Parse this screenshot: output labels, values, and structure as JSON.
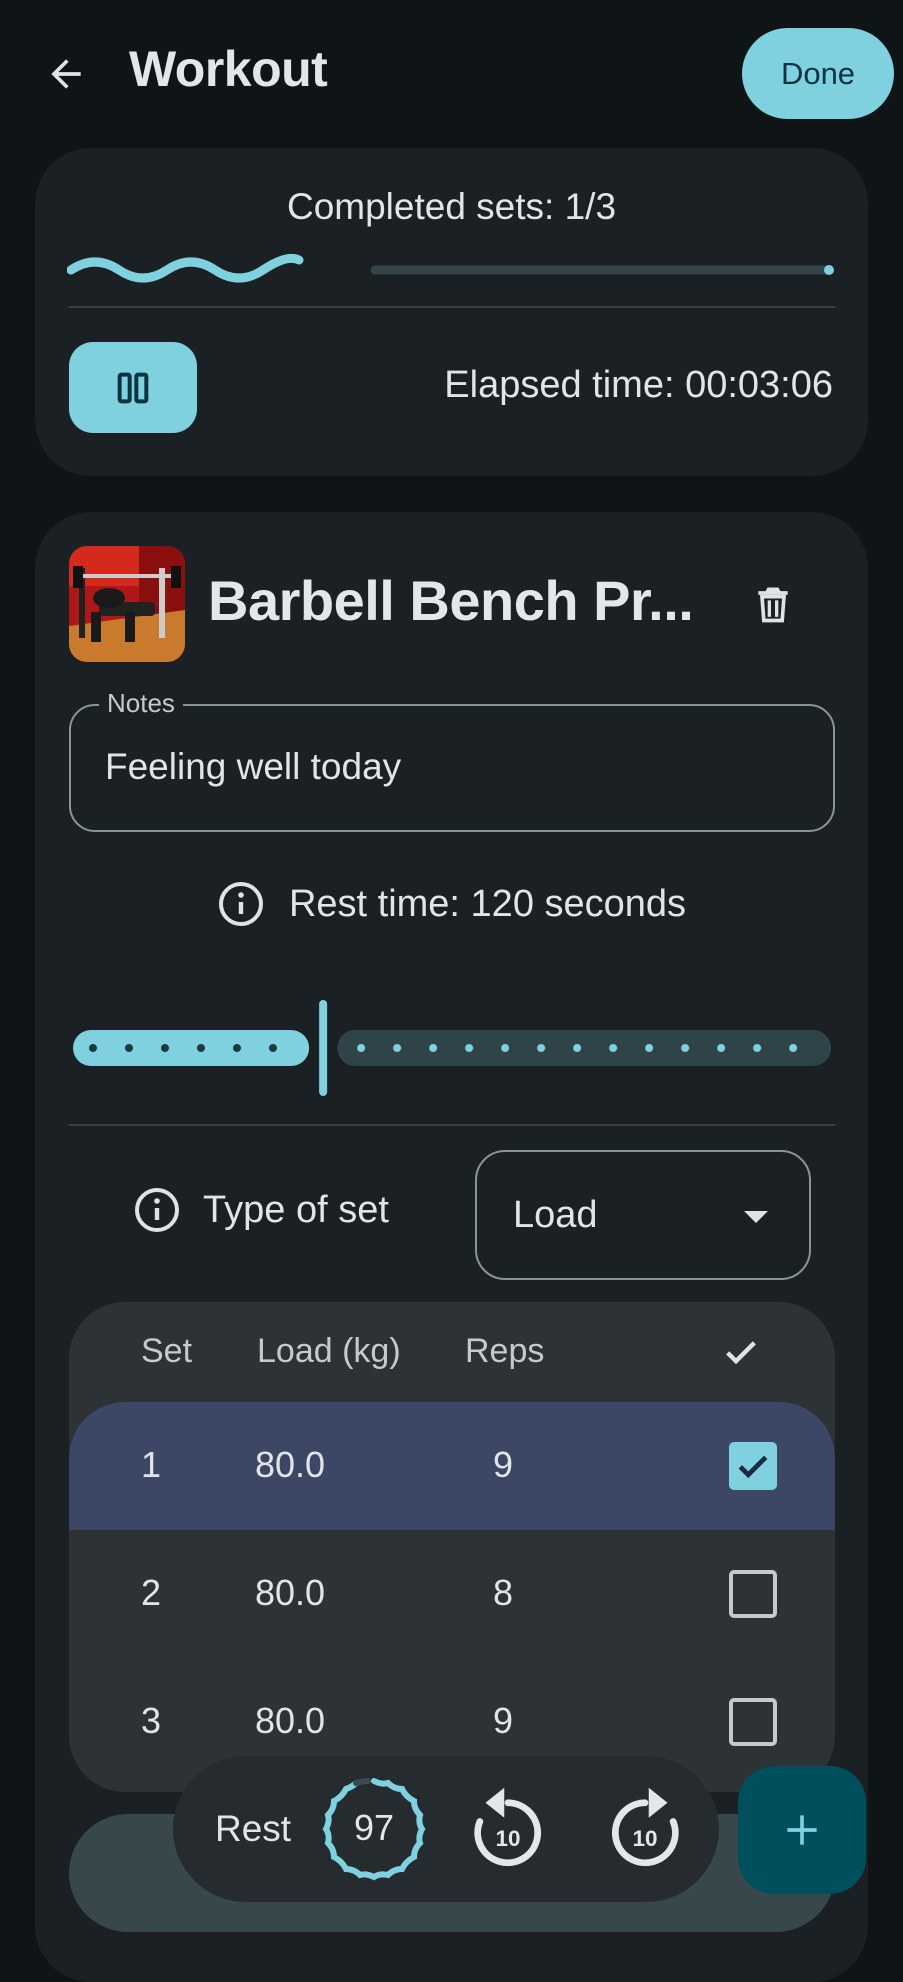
{
  "header": {
    "title": "Workout",
    "done_label": "Done"
  },
  "progress": {
    "completed_text": "Completed sets: 1/3",
    "completed_fraction": 0.333,
    "elapsed_text": "Elapsed time: 00:03:06"
  },
  "exercise": {
    "name": "Barbell Bench Pr...",
    "notes_label": "Notes",
    "notes_value": "Feeling well today",
    "rest_text": "Rest time: 120 seconds",
    "rest_slider_fraction": 0.33,
    "type_label": "Type of set",
    "type_value": "Load"
  },
  "table": {
    "headers": {
      "set": "Set",
      "load": "Load (kg)",
      "reps": "Reps"
    },
    "rows": [
      {
        "set": "1",
        "load": "80.0",
        "reps": "9",
        "done": true
      },
      {
        "set": "2",
        "load": "80.0",
        "reps": "8",
        "done": false
      },
      {
        "set": "3",
        "load": "80.0",
        "reps": "9",
        "done": false
      }
    ]
  },
  "rest_timer": {
    "label": "Rest",
    "count": "97"
  },
  "icons": {
    "back": "arrow-left-icon",
    "pause": "pause-icon",
    "trash": "trash-icon",
    "info": "info-icon",
    "caret": "caret-down-icon",
    "check": "check-icon",
    "rewind": "replay-10-icon",
    "forward": "forward-10-icon",
    "add": "plus-icon"
  },
  "colors": {
    "accent": "#7fd1e0",
    "background": "#0f1417",
    "card": "#1a2023",
    "fab": "#004f5c",
    "completed_row": "#3b4764"
  }
}
